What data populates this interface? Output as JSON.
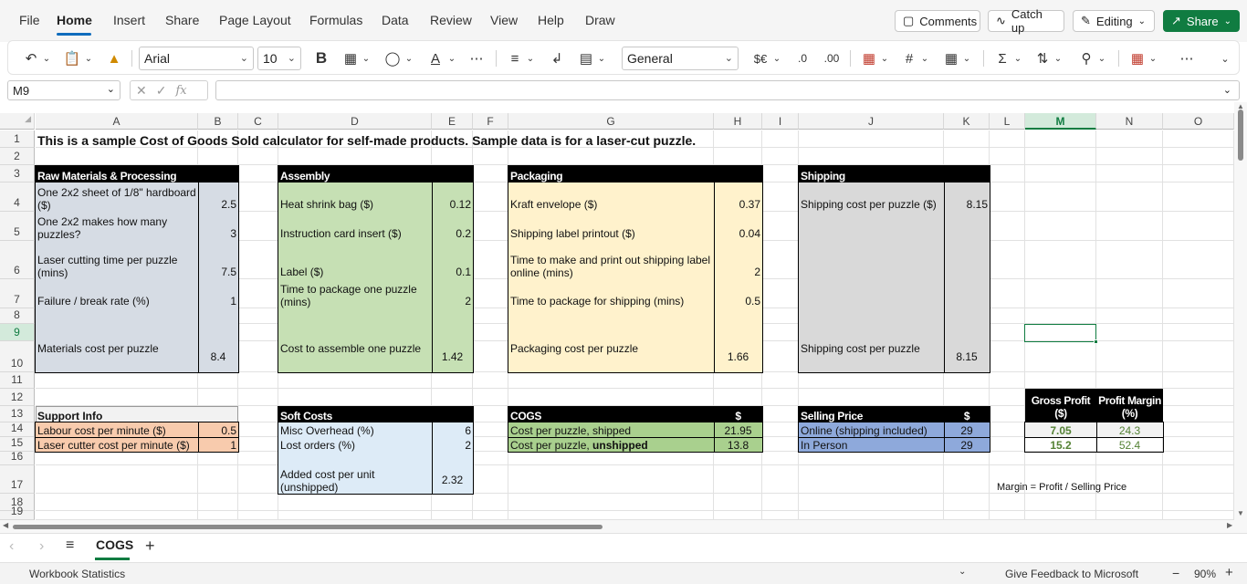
{
  "menu": {
    "items": [
      "File",
      "Home",
      "Insert",
      "Share",
      "Page Layout",
      "Formulas",
      "Data",
      "Review",
      "View",
      "Help",
      "Draw"
    ],
    "active": "Home",
    "comments_label": "Comments",
    "catchup_label": "Catch up",
    "editing_label": "Editing",
    "share_label": "Share"
  },
  "ribbon": {
    "font_name": "Arial",
    "font_size": "10",
    "number_format": "General"
  },
  "formula_bar": {
    "name_box": "M9",
    "fx": "fx",
    "formula": ""
  },
  "columns": [
    "A",
    "B",
    "C",
    "D",
    "E",
    "F",
    "G",
    "H",
    "I",
    "J",
    "K",
    "L",
    "M",
    "N",
    "O"
  ],
  "selected_column": "M",
  "rows": [
    "1",
    "2",
    "3",
    "4",
    "5",
    "6",
    "7",
    "8",
    "9",
    "10",
    "11",
    "12",
    "13",
    "14",
    "15",
    "16",
    "17",
    "18",
    "19"
  ],
  "selected_row": "9",
  "sheet": {
    "title": "This is a sample Cost of Goods Sold calculator for self-made products. Sample data is for a laser-cut puzzle.",
    "raw": {
      "header": "Raw Materials & Processing",
      "r4_label": "One 2x2 sheet of 1/8\" hardboard ($)",
      "r4_value": "2.5",
      "r5_label": "One 2x2 makes how many puzzles?",
      "r5_value": "3",
      "r6_label": "Laser cutting time per puzzle (mins)",
      "r6_value": "7.5",
      "r7_label": "Failure / break rate (%)",
      "r7_value": "1",
      "r10_label": "Materials cost per puzzle",
      "r10_value": "8.4"
    },
    "assembly": {
      "header": "Assembly",
      "r4_label": "Heat shrink bag ($)",
      "r4_value": "0.12",
      "r5_label": "Instruction card insert ($)",
      "r5_value": "0.2",
      "r6_label": "Label ($)",
      "r6_value": "0.1",
      "r7_label": "Time to package one puzzle (mins)",
      "r7_value": "2",
      "r10_label": "Cost to assemble one puzzle",
      "r10_value": "1.42"
    },
    "packaging": {
      "header": "Packaging",
      "r4_label": "Kraft envelope ($)",
      "r4_value": "0.37",
      "r5_label": "Shipping label printout ($)",
      "r5_value": "0.04",
      "r6_label": "Time to make and print out shipping label online (mins)",
      "r6_value": "2",
      "r7_label": "Time to package for shipping (mins)",
      "r7_value": "0.5",
      "r10_label": "Packaging cost per puzzle",
      "r10_value": "1.66"
    },
    "shipping": {
      "header": "Shipping",
      "r4_label": "Shipping cost per puzzle ($)",
      "r4_value": "8.15",
      "r10_label": "Shipping cost per puzzle",
      "r10_value": "8.15"
    },
    "support": {
      "header": "Support Info",
      "r14_label": "Labour cost per minute ($)",
      "r14_value": "0.5",
      "r15_label": "Laser cutter cost per minute ($)",
      "r15_value": "1"
    },
    "soft": {
      "header": "Soft Costs",
      "r14_label": "Misc Overhead (%)",
      "r14_value": "6",
      "r15_label": "Lost orders (%)",
      "r15_value": "2",
      "r17_label": "Added cost per unit (unshipped)",
      "r17_value": "2.32"
    },
    "cogs": {
      "header": "COGS",
      "header_unit": "$",
      "r14_label": "Cost per puzzle, shipped",
      "r14_value": "21.95",
      "r15_label_a": "Cost per puzzle, ",
      "r15_label_b": "unshipped",
      "r15_value": "13.8"
    },
    "selling": {
      "header": "Selling Price",
      "header_unit": "$",
      "r14_label": "Online (shipping included)",
      "r14_value": "29",
      "r15_label": "In Person",
      "r15_value": "29"
    },
    "profit": {
      "gross_header": "Gross Profit ($)",
      "margin_header": "Profit Margin (%)",
      "r14_gross": "7.05",
      "r14_margin": "24.3",
      "r15_gross": "15.2",
      "r15_margin": "52.4",
      "note": "Margin = Profit / Selling Price"
    }
  },
  "tabs": {
    "sheet_name": "COGS"
  },
  "status": {
    "workbook_statistics": "Workbook Statistics",
    "feedback": "Give Feedback to Microsoft",
    "zoom": "90%"
  },
  "colors": {
    "excel_green": "#107c41",
    "raw_fill": "#d6dce4",
    "assembly_fill": "#c6e0b4",
    "packaging_fill": "#fff2cc",
    "shipping_fill": "#d9d9d9",
    "support_fill": "#f8cbad",
    "soft_fill": "#ddebf7",
    "cogs_fill": "#a9d08e",
    "selling_fill": "#8ea9db"
  }
}
